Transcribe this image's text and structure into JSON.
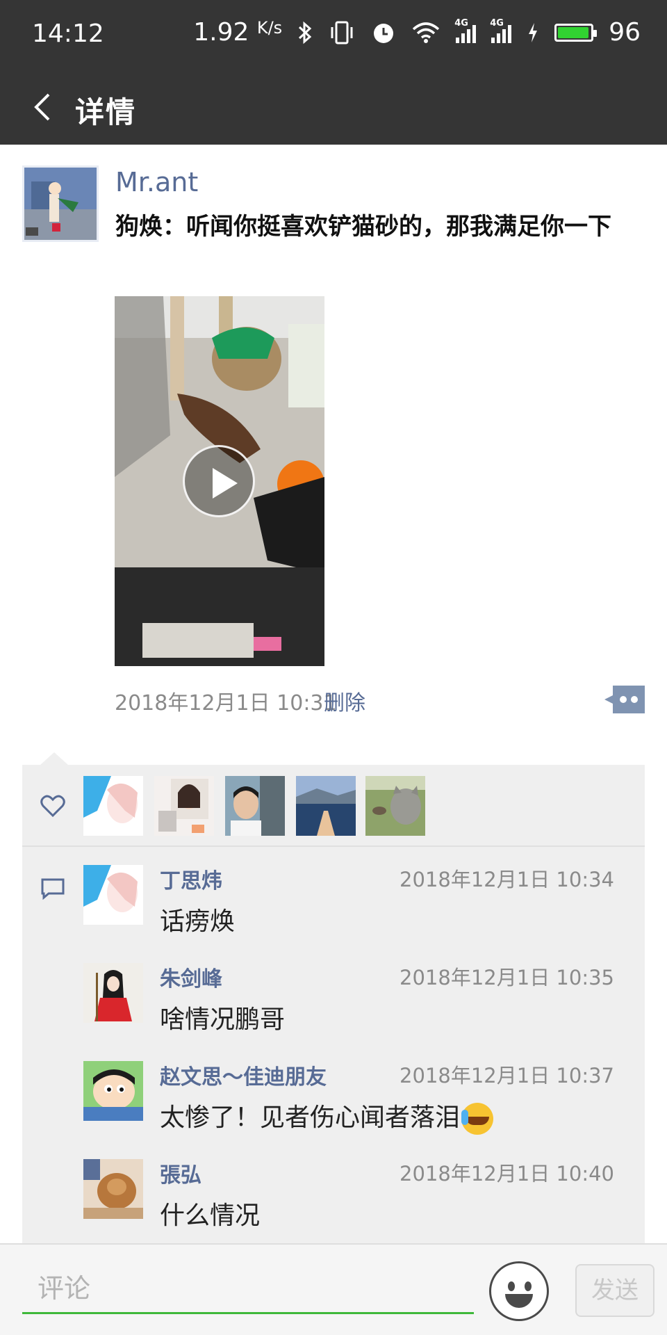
{
  "status_bar": {
    "time": "14:12",
    "net_speed": "1.92",
    "net_unit": "K/s",
    "signal1_label": "4G",
    "signal2_label": "4G",
    "battery": "96",
    "battery_level": 0.96,
    "icons": [
      "bluetooth-icon",
      "vibrate-icon",
      "alarm-icon",
      "wifi-icon",
      "signal-icon",
      "charging-icon",
      "battery-icon"
    ]
  },
  "header": {
    "title": "详情",
    "back_icon": "chevron-left-icon"
  },
  "post": {
    "author": "Mr.ant",
    "text": "狗焕：听闻你挺喜欢铲猫砂的，那我满足你一下",
    "timestamp": "2018年12月1日 10:31",
    "delete_label": "删除"
  },
  "likes": {
    "icon": "heart-icon",
    "avatars": [
      "anime-girl",
      "portrait-collage",
      "man-selfie",
      "seaside-view",
      "cats-on-grass"
    ]
  },
  "comments": [
    {
      "name": "丁思炜",
      "time": "2018年12月1日 10:34",
      "text": "话痨焕"
    },
    {
      "name": "朱剑峰",
      "time": "2018年12月1日 10:35",
      "text": "啥情况鹏哥"
    },
    {
      "name": "赵文思～佳迪朋友",
      "time": "2018年12月1日 10:37",
      "text": "太惨了！见者伤心闻者落泪",
      "emoji": "crying-laughing-emoji"
    },
    {
      "name": "張弘",
      "time": "2018年12月1日 10:40",
      "text": "什么情况"
    }
  ],
  "input_bar": {
    "placeholder": "评论",
    "send_label": "发送",
    "emoji_icon": "smiley-icon",
    "accent_color": "#3fb83a"
  },
  "colors": {
    "header_bg": "#353535",
    "link_blue": "#576b95",
    "panel_bg": "#efefef"
  }
}
